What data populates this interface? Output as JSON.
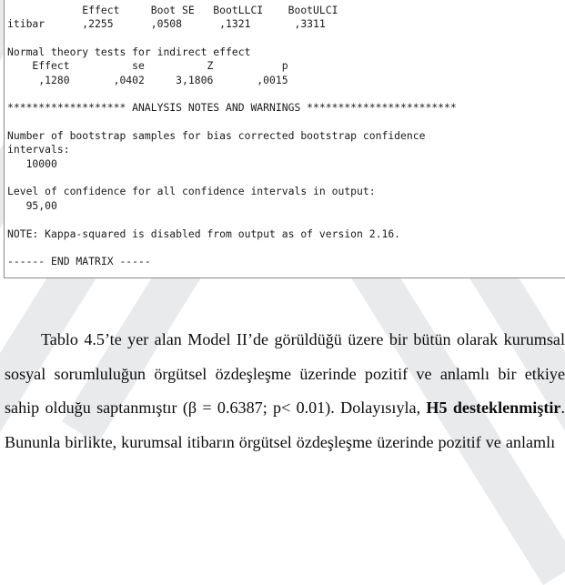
{
  "document": {
    "page_kind": "thesis-page-with-spss-output"
  },
  "spss_output": {
    "indirect_effect_table": {
      "headers": [
        "Effect",
        "Boot SE",
        "BootLLCI",
        "BootULCI"
      ],
      "row_label": "itibar",
      "values": [
        ",2255",
        ",0508",
        ",1321",
        ",3311"
      ]
    },
    "normal_theory": {
      "title": "Normal theory tests for indirect effect",
      "headers": [
        "Effect",
        "se",
        "Z",
        "p"
      ],
      "values": [
        ",1280",
        ",0402",
        "3,1806",
        ",0015"
      ]
    },
    "section_banner": {
      "leading_stars": "*******************",
      "title": "ANALYSIS NOTES AND WARNINGS",
      "trailing_stars": "************************"
    },
    "notes": {
      "bootstrap_label_line1": "Number of bootstrap samples for bias corrected bootstrap confidence",
      "bootstrap_label_line2": "intervals:",
      "bootstrap_value": "10000",
      "confidence_label": "Level of confidence for all confidence intervals in output:",
      "confidence_value": "95,00",
      "kappa_note": "NOTE: Kappa-squared is disabled from output as of version 2.16.",
      "end_matrix": "------ END MATRIX -----"
    },
    "full_text": "            Effect     Boot SE   BootLLCI    BootULCI\nitibar      ,2255      ,0508      ,1321       ,3311\n\nNormal theory tests for indirect effect\n    Effect          se          Z           p\n     ,1280       ,0402     3,1806       ,0015\n\n******************* ANALYSIS NOTES AND WARNINGS ************************\n\nNumber of bootstrap samples for bias corrected bootstrap confidence\nintervals:\n   10000\n\nLevel of confidence for all confidence intervals in output:\n   95,00\n\nNOTE: Kappa-squared is disabled from output as of version 2.16.\n\n------ END MATRIX -----"
  },
  "prose": {
    "paragraph_part1": "Tablo 4.5’te yer alan Model II’de görüldüğü üzere bir bütün olarak kurumsal sosyal sorumluluğun örgütsel özdeşleşme üzerinde pozitif ve anlamlı bir etkiye sahip olduğu saptanmıştır  (β = 0.6387; p< 0.01). Dolayısıyla, ",
    "bold_claim": "H5 desteklenmiştir",
    "paragraph_part2": ". Bununla birlikte, kurumsal itibarın örgütsel özdeşleşme üzerinde pozitif ve anlamlı"
  }
}
